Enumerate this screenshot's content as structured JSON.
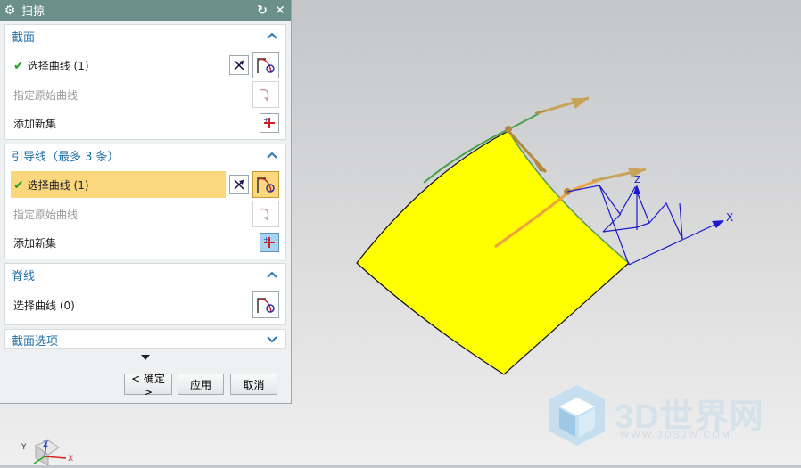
{
  "dialog": {
    "title": "扫掠",
    "sections": {
      "section": {
        "header": "截面",
        "select_curve": "选择曲线 (1)",
        "specify_origin_curve": "指定原始曲线",
        "add_new_set": "添加新集"
      },
      "guide": {
        "header": "引导线（最多 3 条）",
        "select_curve": "选择曲线 (1)",
        "specify_origin_curve": "指定原始曲线",
        "add_new_set": "添加新集"
      },
      "spine": {
        "header": "脊线",
        "select_curve": "选择曲线 (0)"
      },
      "section_options": {
        "header": "截面选项"
      }
    },
    "buttons": {
      "ok": "< 确定 >",
      "apply": "应用",
      "cancel": "取消"
    }
  },
  "viewport": {
    "wcs_z": "Z",
    "wcs_x": "X",
    "triad_x": "X",
    "triad_y": "Y",
    "triad_z": "Z"
  },
  "watermark": {
    "text": "3D世界网",
    "url": "WWW.3DSJW.COM"
  },
  "colors": {
    "title_bar": "#6b8f8a",
    "header_text": "#1f6fa8",
    "selected_row": "#fbd77d",
    "surface": "#ffff00",
    "guide_curve": "#f0a040",
    "section_curve": "#4aa04a",
    "wcs": "#1a1acc"
  }
}
